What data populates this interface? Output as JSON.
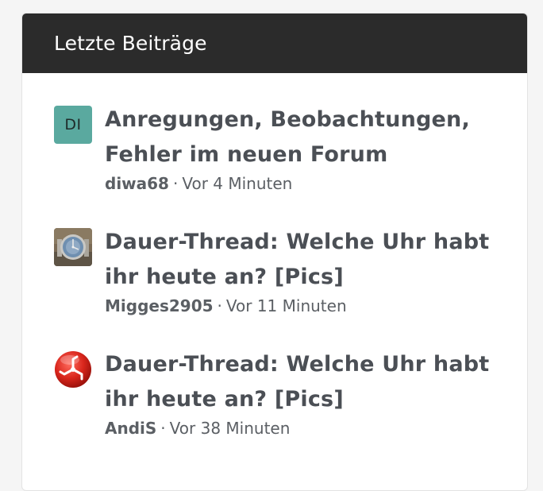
{
  "widget": {
    "title": "Letzte Beiträge"
  },
  "posts": [
    {
      "avatar_letters": "DI",
      "avatar_color": "#5aa99f",
      "title": "Anregungen, Beobachtungen, Fehler im neuen Forum",
      "author": "diwa68",
      "separator": "·",
      "time": "Vor 4 Minuten"
    },
    {
      "avatar_icon": "wristwatch-photo-icon",
      "title": "Dauer-Thread: Welche Uhr habt ihr heute an? [Pics]",
      "author": "Migges2905",
      "separator": "·",
      "time": "Vor 11 Minuten"
    },
    {
      "avatar_icon": "triskelion-red-badge-icon",
      "title": "Dauer-Thread: Welche Uhr habt ihr heute an? [Pics]",
      "author": "AndiS",
      "separator": "·",
      "time": "Vor 38 Minuten"
    }
  ]
}
